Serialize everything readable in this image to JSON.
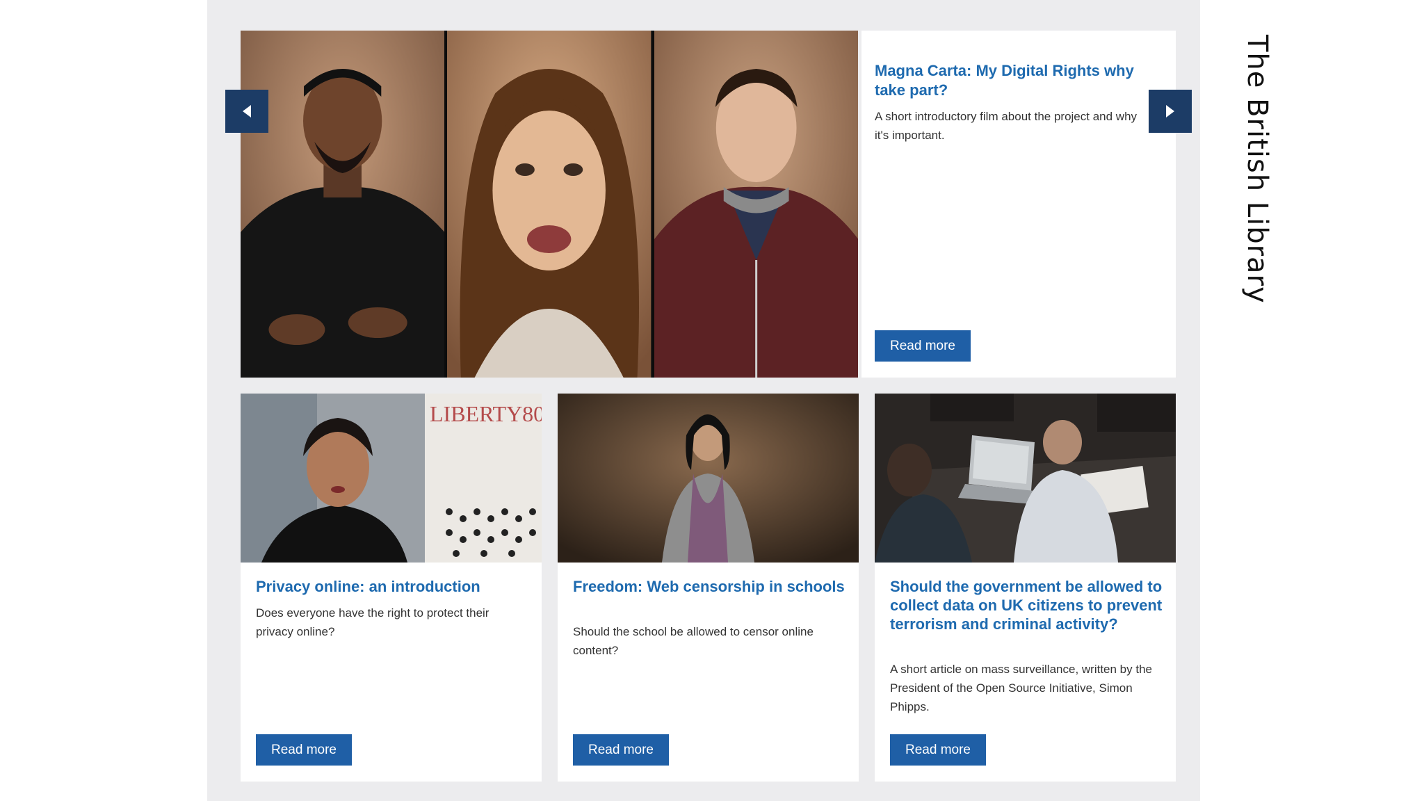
{
  "side_label": "The British Library",
  "colors": {
    "link_blue": "#1e6aaf",
    "button_blue": "#1f5fa6",
    "arrow_navy": "#1c3c66",
    "panel_grey": "#ececee"
  },
  "carousel": {
    "prev_icon": "chevron-left-icon",
    "next_icon": "chevron-right-icon",
    "feature": {
      "title": "Magna Carta: My Digital Rights why take part?",
      "description": "A short introductory film about the project and why it's important.",
      "button_label": "Read more"
    },
    "video_frames": [
      "young-man-speaking",
      "young-woman-speaking",
      "teen-boy-speaking"
    ]
  },
  "cards": [
    {
      "image_text": "LIBERTY80",
      "title": "Privacy online: an introduction",
      "description": "Does everyone have the right to protect their privacy online?",
      "button_label": "Read more"
    },
    {
      "title": "Freedom: Web censorship in schools",
      "description": "Should the school be allowed to censor online content?",
      "button_label": "Read more"
    },
    {
      "title": "Should the government be allowed to collect data on UK citizens to prevent terrorism and criminal activity?",
      "description": "A short article on mass surveillance, written by the President of the Open Source Initiative, Simon Phipps.",
      "button_label": "Read more"
    }
  ]
}
